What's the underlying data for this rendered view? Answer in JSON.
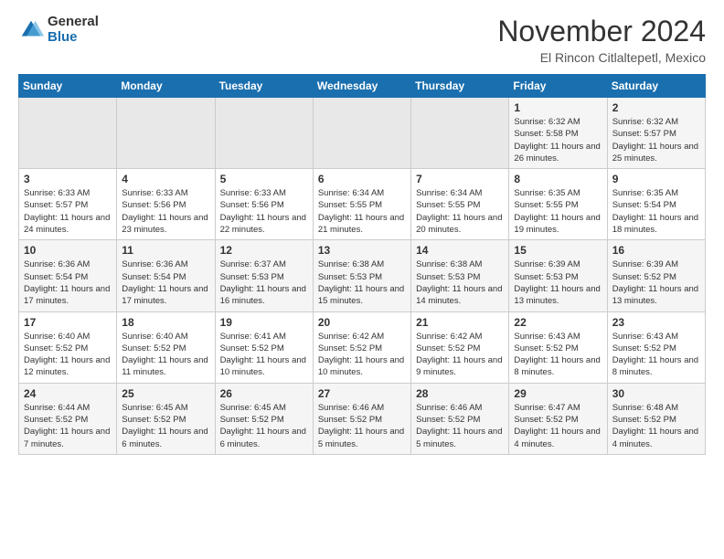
{
  "header": {
    "logo_general": "General",
    "logo_blue": "Blue",
    "month_title": "November 2024",
    "location": "El Rincon Citlaltepetl, Mexico"
  },
  "days_of_week": [
    "Sunday",
    "Monday",
    "Tuesday",
    "Wednesday",
    "Thursday",
    "Friday",
    "Saturday"
  ],
  "weeks": [
    [
      {
        "day": "",
        "info": ""
      },
      {
        "day": "",
        "info": ""
      },
      {
        "day": "",
        "info": ""
      },
      {
        "day": "",
        "info": ""
      },
      {
        "day": "",
        "info": ""
      },
      {
        "day": "1",
        "info": "Sunrise: 6:32 AM\nSunset: 5:58 PM\nDaylight: 11 hours and 26 minutes."
      },
      {
        "day": "2",
        "info": "Sunrise: 6:32 AM\nSunset: 5:57 PM\nDaylight: 11 hours and 25 minutes."
      }
    ],
    [
      {
        "day": "3",
        "info": "Sunrise: 6:33 AM\nSunset: 5:57 PM\nDaylight: 11 hours and 24 minutes."
      },
      {
        "day": "4",
        "info": "Sunrise: 6:33 AM\nSunset: 5:56 PM\nDaylight: 11 hours and 23 minutes."
      },
      {
        "day": "5",
        "info": "Sunrise: 6:33 AM\nSunset: 5:56 PM\nDaylight: 11 hours and 22 minutes."
      },
      {
        "day": "6",
        "info": "Sunrise: 6:34 AM\nSunset: 5:55 PM\nDaylight: 11 hours and 21 minutes."
      },
      {
        "day": "7",
        "info": "Sunrise: 6:34 AM\nSunset: 5:55 PM\nDaylight: 11 hours and 20 minutes."
      },
      {
        "day": "8",
        "info": "Sunrise: 6:35 AM\nSunset: 5:55 PM\nDaylight: 11 hours and 19 minutes."
      },
      {
        "day": "9",
        "info": "Sunrise: 6:35 AM\nSunset: 5:54 PM\nDaylight: 11 hours and 18 minutes."
      }
    ],
    [
      {
        "day": "10",
        "info": "Sunrise: 6:36 AM\nSunset: 5:54 PM\nDaylight: 11 hours and 17 minutes."
      },
      {
        "day": "11",
        "info": "Sunrise: 6:36 AM\nSunset: 5:54 PM\nDaylight: 11 hours and 17 minutes."
      },
      {
        "day": "12",
        "info": "Sunrise: 6:37 AM\nSunset: 5:53 PM\nDaylight: 11 hours and 16 minutes."
      },
      {
        "day": "13",
        "info": "Sunrise: 6:38 AM\nSunset: 5:53 PM\nDaylight: 11 hours and 15 minutes."
      },
      {
        "day": "14",
        "info": "Sunrise: 6:38 AM\nSunset: 5:53 PM\nDaylight: 11 hours and 14 minutes."
      },
      {
        "day": "15",
        "info": "Sunrise: 6:39 AM\nSunset: 5:53 PM\nDaylight: 11 hours and 13 minutes."
      },
      {
        "day": "16",
        "info": "Sunrise: 6:39 AM\nSunset: 5:52 PM\nDaylight: 11 hours and 13 minutes."
      }
    ],
    [
      {
        "day": "17",
        "info": "Sunrise: 6:40 AM\nSunset: 5:52 PM\nDaylight: 11 hours and 12 minutes."
      },
      {
        "day": "18",
        "info": "Sunrise: 6:40 AM\nSunset: 5:52 PM\nDaylight: 11 hours and 11 minutes."
      },
      {
        "day": "19",
        "info": "Sunrise: 6:41 AM\nSunset: 5:52 PM\nDaylight: 11 hours and 10 minutes."
      },
      {
        "day": "20",
        "info": "Sunrise: 6:42 AM\nSunset: 5:52 PM\nDaylight: 11 hours and 10 minutes."
      },
      {
        "day": "21",
        "info": "Sunrise: 6:42 AM\nSunset: 5:52 PM\nDaylight: 11 hours and 9 minutes."
      },
      {
        "day": "22",
        "info": "Sunrise: 6:43 AM\nSunset: 5:52 PM\nDaylight: 11 hours and 8 minutes."
      },
      {
        "day": "23",
        "info": "Sunrise: 6:43 AM\nSunset: 5:52 PM\nDaylight: 11 hours and 8 minutes."
      }
    ],
    [
      {
        "day": "24",
        "info": "Sunrise: 6:44 AM\nSunset: 5:52 PM\nDaylight: 11 hours and 7 minutes."
      },
      {
        "day": "25",
        "info": "Sunrise: 6:45 AM\nSunset: 5:52 PM\nDaylight: 11 hours and 6 minutes."
      },
      {
        "day": "26",
        "info": "Sunrise: 6:45 AM\nSunset: 5:52 PM\nDaylight: 11 hours and 6 minutes."
      },
      {
        "day": "27",
        "info": "Sunrise: 6:46 AM\nSunset: 5:52 PM\nDaylight: 11 hours and 5 minutes."
      },
      {
        "day": "28",
        "info": "Sunrise: 6:46 AM\nSunset: 5:52 PM\nDaylight: 11 hours and 5 minutes."
      },
      {
        "day": "29",
        "info": "Sunrise: 6:47 AM\nSunset: 5:52 PM\nDaylight: 11 hours and 4 minutes."
      },
      {
        "day": "30",
        "info": "Sunrise: 6:48 AM\nSunset: 5:52 PM\nDaylight: 11 hours and 4 minutes."
      }
    ]
  ]
}
